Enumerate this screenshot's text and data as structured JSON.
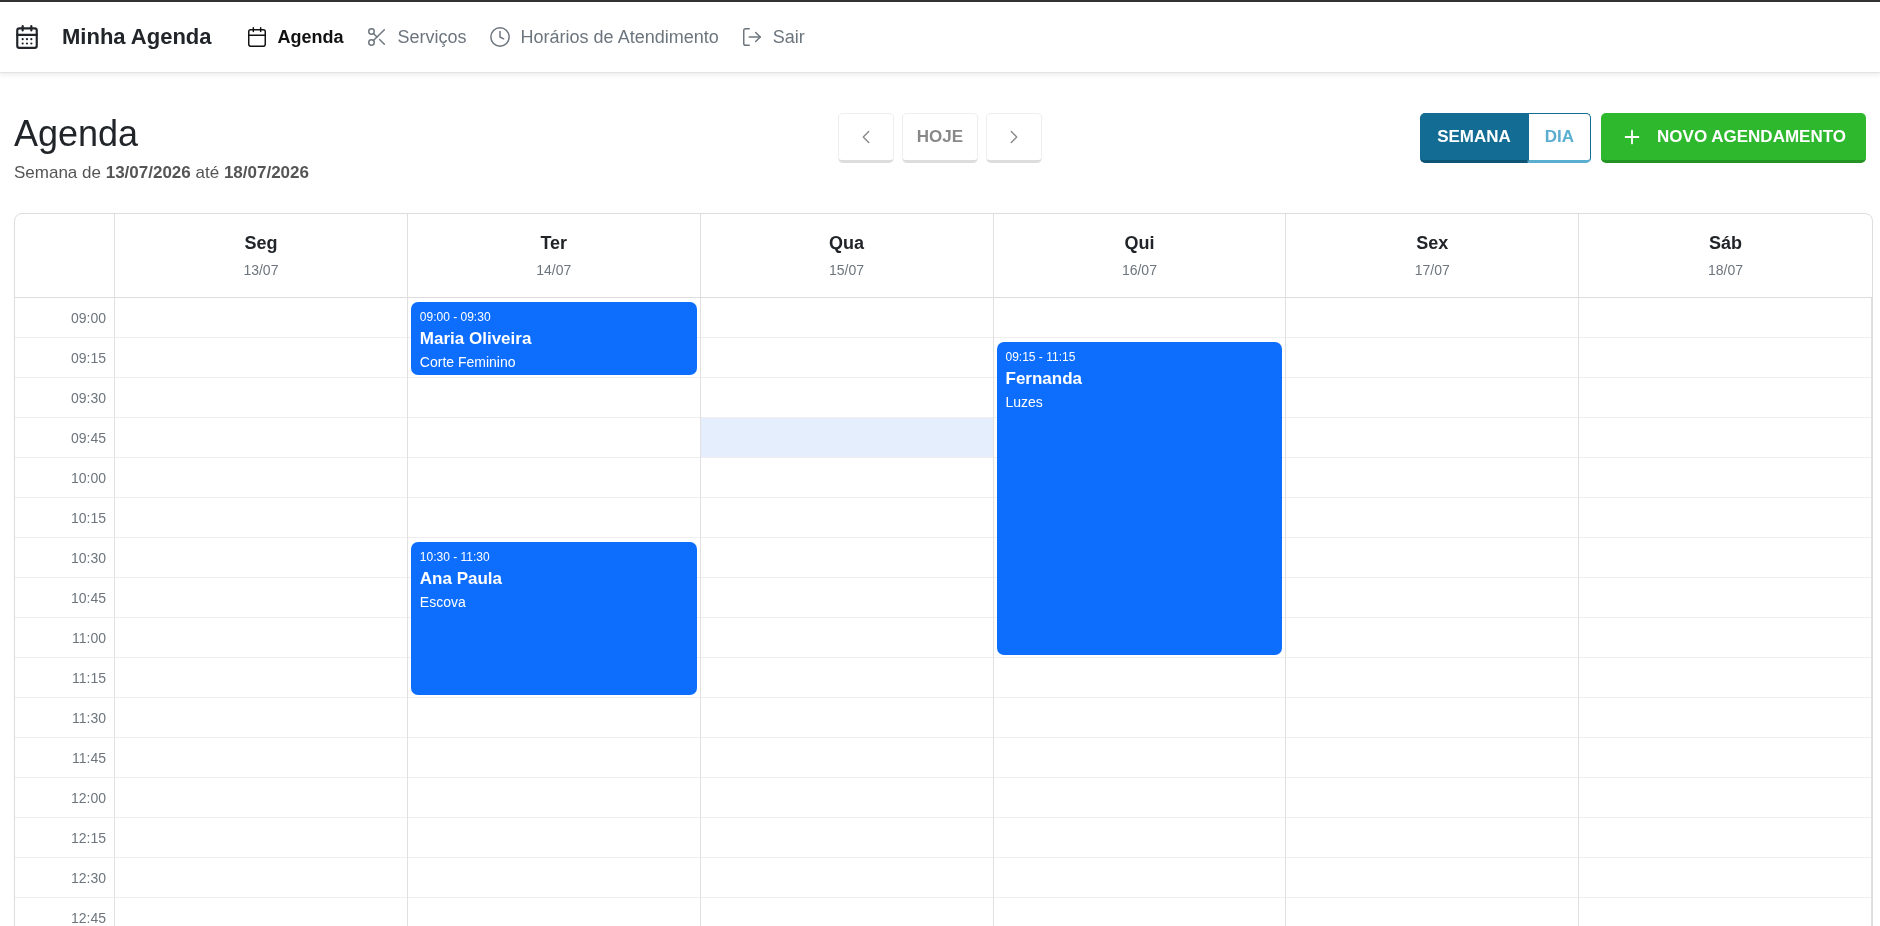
{
  "brand": {
    "title": "Minha Agenda"
  },
  "nav": [
    {
      "label": "Agenda",
      "selected": true
    },
    {
      "label": "Serviços",
      "selected": false
    },
    {
      "label": "Horários de Atendimento",
      "selected": false
    },
    {
      "label": "Sair",
      "selected": false
    }
  ],
  "page": {
    "title": "Agenda",
    "subtitle": "Semana de **13/07/2026** até **18/07/2026**"
  },
  "pager": {
    "today": "HOJE"
  },
  "views": [
    {
      "label": "SEMANA",
      "selected": true
    },
    {
      "label": "DIA",
      "selected": false
    }
  ],
  "new_button": {
    "label": "NOVO AGENDAMENTO"
  },
  "times": [
    {
      "label": "09:00",
      "highlighted": false
    },
    {
      "label": "09:15",
      "highlighted": false
    },
    {
      "label": "09:30",
      "highlighted": false
    },
    {
      "label": "09:45",
      "highlighted": true
    },
    {
      "label": "10:00",
      "highlighted": false
    },
    {
      "label": "10:15",
      "highlighted": false
    },
    {
      "label": "10:30",
      "highlighted": false
    },
    {
      "label": "10:45",
      "highlighted": false
    },
    {
      "label": "11:00",
      "highlighted": false
    },
    {
      "label": "11:15",
      "highlighted": false
    },
    {
      "label": "11:30",
      "highlighted": false
    },
    {
      "label": "11:45",
      "highlighted": false
    },
    {
      "label": "12:00",
      "highlighted": false
    },
    {
      "label": "12:15",
      "highlighted": false
    },
    {
      "label": "12:30",
      "highlighted": false
    },
    {
      "label": "12:45"
    }
  ],
  "days": [
    {
      "name": "Seg",
      "date": "13/07",
      "highlighted": false
    },
    {
      "name": "Ter",
      "date": "14/07",
      "highlighted": false,
      "events": [
        {
          "time": "09:00 - 09:30",
          "client": "Maria Oliveira",
          "service": "Corte Feminino"
        },
        {
          "time": "10:30 - 11:30",
          "client": "Ana Paula",
          "service": "Escova"
        }
      ]
    },
    {
      "name": "Qua",
      "date": "15/07",
      "highlighted": true
    },
    {
      "name": "Qui",
      "date": "16/07",
      "highlighted": false,
      "events": [
        {
          "time": "09:15 - 11:15",
          "client": "Fernanda",
          "service": "Luzes"
        }
      ]
    },
    {
      "name": "Sex",
      "date": "17/07",
      "highlighted": false
    },
    {
      "name": "Sáb",
      "date": "18/07",
      "highlighted": false
    }
  ]
}
